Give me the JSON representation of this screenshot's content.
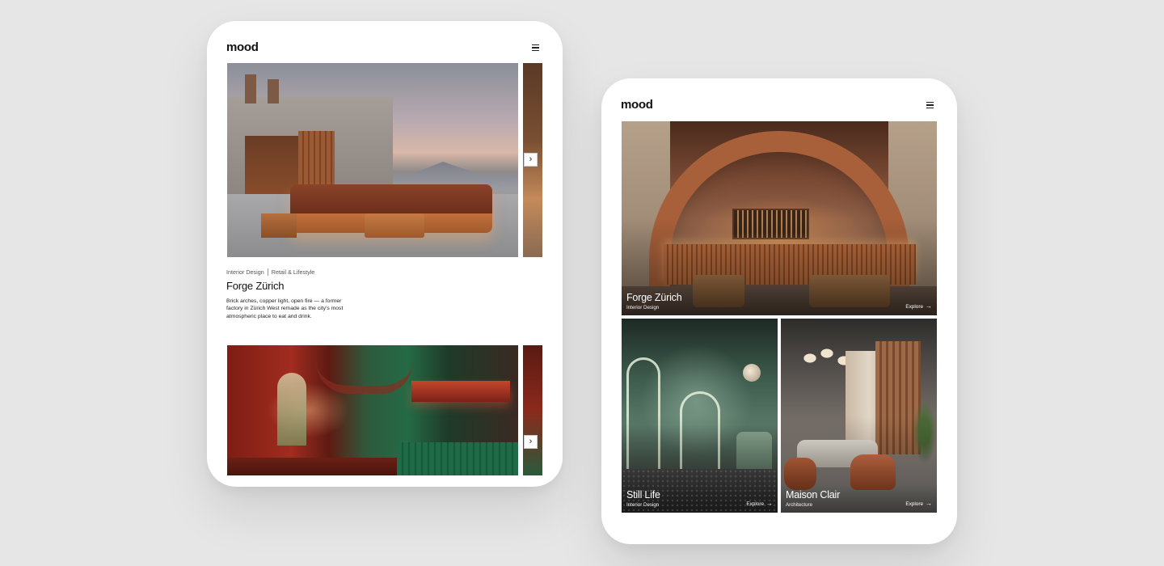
{
  "brand": {
    "logo": "mood"
  },
  "device_carousel": {
    "projects": [
      {
        "categories": [
          "Interior Design",
          "Retail & Lifestyle"
        ],
        "title": "Forge Zürich",
        "description": "Brick arches, copper light, open fire — a former factory in Zürich West remade as the city's most atmospheric place to eat and drink."
      }
    ],
    "next_glyph": "›"
  },
  "device_grid": {
    "tiles": [
      {
        "title": "Forge Zürich",
        "category": "Interior Design",
        "cta": "Explore"
      },
      {
        "title": "Still Life",
        "category": "Interior Design",
        "cta": "Explore"
      },
      {
        "title": "Maison Clair",
        "category": "Architecture",
        "cta": "Explore"
      }
    ],
    "arrow_glyph": "→"
  },
  "icons": [
    "menu-icon",
    "chevron-right-icon",
    "arrow-right-icon"
  ],
  "colors": {
    "background": "#e6e6e6",
    "card": "#ffffff",
    "text": "#111111"
  }
}
